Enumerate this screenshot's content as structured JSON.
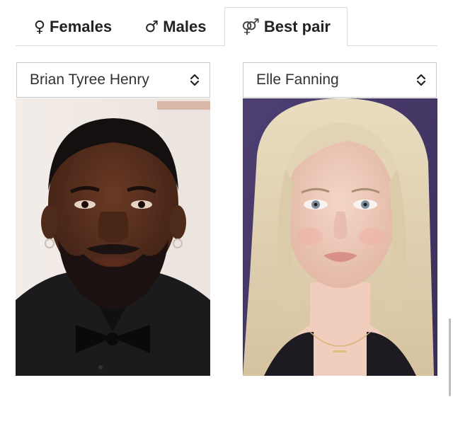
{
  "tabs": [
    {
      "label": "Females",
      "glyph": "♀"
    },
    {
      "label": "Males",
      "glyph": "♂"
    },
    {
      "label": "Best pair",
      "glyph": "⚤"
    }
  ],
  "active_tab": "Best pair",
  "left_select": {
    "value": "Brian Tyree Henry"
  },
  "right_select": {
    "value": "Elle Fanning"
  },
  "icons": {
    "select_chevron": "chevron-up-down-icon"
  }
}
